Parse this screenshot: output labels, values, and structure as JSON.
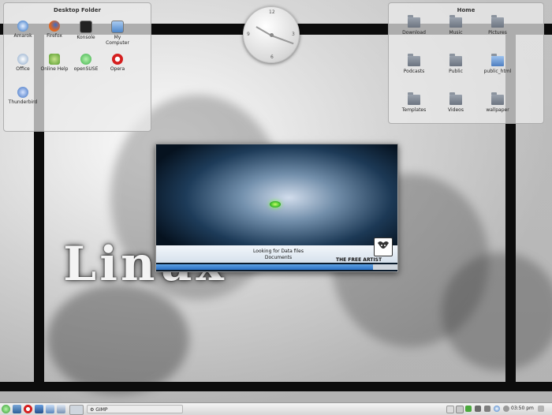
{
  "desktop_folder": {
    "title": "Desktop Folder",
    "items": [
      {
        "label": "Amarok",
        "icon": "amarok-icon",
        "color": "#2b6fc4"
      },
      {
        "label": "Firefox",
        "icon": "firefox-icon",
        "color": "#e2661f"
      },
      {
        "label": "Konsole",
        "icon": "konsole-icon",
        "color": "#222222"
      },
      {
        "label": "My Computer",
        "icon": "computer-icon",
        "color": "#4d86c9"
      },
      {
        "label": "Office",
        "icon": "office-icon",
        "color": "#8aa7c9"
      },
      {
        "label": "Online Help",
        "icon": "help-icon",
        "color": "#5a9e2f"
      },
      {
        "label": "openSUSE",
        "icon": "opensuse-icon",
        "color": "#3cb04a"
      },
      {
        "label": "Opera",
        "icon": "opera-icon",
        "color": "#d51f1f"
      },
      {
        "label": "Thunderbird",
        "icon": "thunderbird-icon",
        "color": "#3a6ec0"
      }
    ]
  },
  "home_folder": {
    "title": "Home",
    "items": [
      {
        "label": "Download",
        "icon": "folder-icon"
      },
      {
        "label": "Music",
        "icon": "folder-icon"
      },
      {
        "label": "Pictures",
        "icon": "folder-icon"
      },
      {
        "label": "Podcasts",
        "icon": "folder-icon"
      },
      {
        "label": "Public",
        "icon": "folder-icon"
      },
      {
        "label": "public_html",
        "icon": "folder-icon"
      },
      {
        "label": "Templates",
        "icon": "folder-icon"
      },
      {
        "label": "Videos",
        "icon": "folder-icon"
      },
      {
        "label": "wallpaper",
        "icon": "folder-icon"
      }
    ]
  },
  "clock_widget": {
    "n12": "12",
    "n3": "3",
    "n6": "6",
    "n9": "9"
  },
  "wallpaper": {
    "text": "Linux"
  },
  "splash": {
    "message_line1": "Looking for Data files",
    "message_line2": "Documents",
    "brand": "THE FREE ARTIST",
    "progress": 0.9
  },
  "taskbar": {
    "task_label": "GIMP",
    "time": "03:50 pm"
  }
}
